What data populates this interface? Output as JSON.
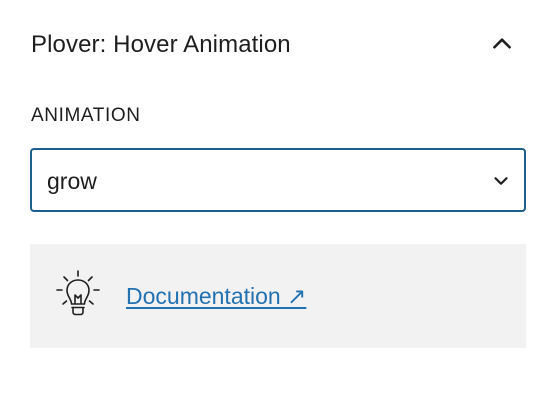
{
  "panel": {
    "title": "Plover: Hover Animation",
    "toggle_icon": "chevron-up-icon"
  },
  "animation": {
    "label": "ANIMATION",
    "selected_value": "grow",
    "dropdown_icon": "chevron-down-icon"
  },
  "notice": {
    "icon": "lightbulb-icon",
    "link_text": "Documentation ↗"
  },
  "colors": {
    "accent": "#2271b1",
    "select_border": "#1f5f8b",
    "notice_background": "#f2f2f2",
    "text": "#1e1e1e"
  }
}
